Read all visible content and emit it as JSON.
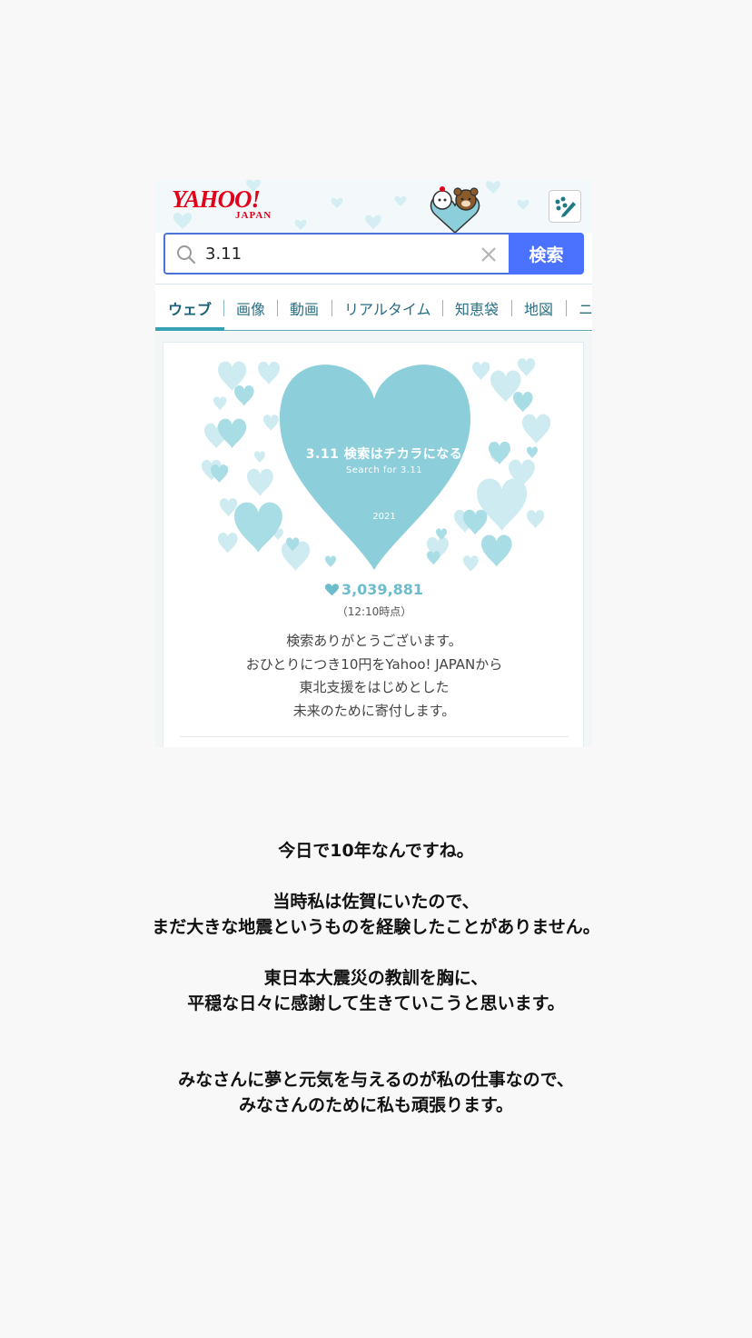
{
  "screenshot": {
    "logo": {
      "main": "YAHOO!",
      "sub": "JAPAN"
    },
    "search": {
      "value": "3.11",
      "button_label": "検索"
    },
    "tabs": [
      {
        "label": "ウェブ",
        "active": true
      },
      {
        "label": "画像"
      },
      {
        "label": "動画"
      },
      {
        "label": "リアルタイム"
      },
      {
        "label": "知恵袋"
      },
      {
        "label": "地図"
      },
      {
        "label": "ニ"
      }
    ],
    "banner": {
      "title": "3.11 検索はチカラになる",
      "subtitle": "Search for 3.11",
      "year": "2021",
      "count": "3,039,881",
      "time": "（12:10時点）",
      "message": [
        "検索ありがとうございます。",
        "おひとりにつき10円をYahoo! JAPANから",
        "東北支援をはじめとした",
        "未来のために寄付します。"
      ]
    },
    "colors": {
      "heart": "#8ccfdb",
      "heart_light": "#cdebf0",
      "search_button": "#4b72ff",
      "logo": "#e2001a"
    }
  },
  "caption": {
    "paragraphs": [
      [
        "今日で10年なんですね。"
      ],
      [
        "当時私は佐賀にいたので、",
        "まだ大きな地震というものを経験したことがありません。"
      ],
      [
        "東日本大震災の教訓を胸に、",
        "平穏な日々に感謝して生きていこうと思います。"
      ],
      [
        "みなさんに夢と元気を与えるのが私の仕事なので、",
        "みなさんのために私も頑張ります。"
      ]
    ]
  }
}
